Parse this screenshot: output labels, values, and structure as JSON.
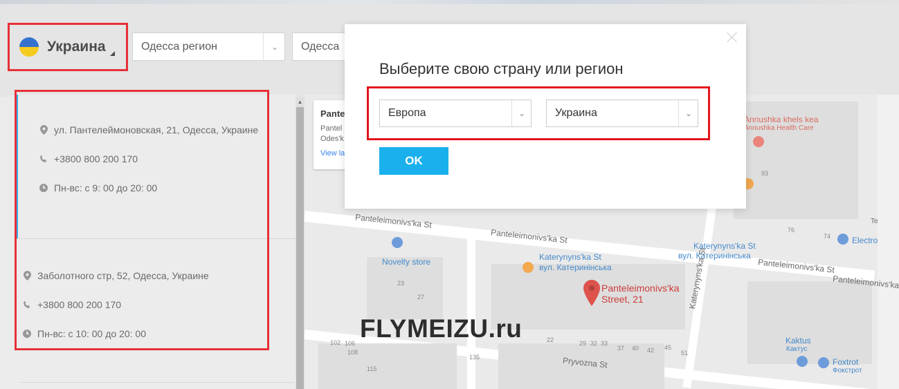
{
  "header": {
    "country_selector": {
      "name": "Украина",
      "flag_icon": "ukraine-flag-icon"
    },
    "region_select": {
      "value": "Одесса регион"
    },
    "city_select": {
      "value": "Одесса"
    }
  },
  "stores": [
    {
      "address": "ул. Пантелеймоновская, 21, Одесса, Украине",
      "phone": "+3800 800 200 170",
      "hours": "Пн-вс: с 9: 00 до 20: 00"
    },
    {
      "address": "Заболотного стр, 52, Одесса, Украине",
      "phone": "+3800 800 200 170",
      "hours": "Пн-вс: с 10: 00 до 20: 00"
    }
  ],
  "map": {
    "card": {
      "title": "Pante",
      "addr_line1": "Pantel",
      "addr_line2": "Odes'k",
      "link": "View la"
    },
    "labels": {
      "street1": "Panteleimonivs'ka St",
      "street2": "Panteleimonivs'ka St",
      "street3": "Panteleimonivs'ka St",
      "street4": "Panteleimonivs'ka St",
      "pryvozna": "Pryvozna St",
      "kateryn_v": "Katerynyns'ka St",
      "novelty": "Novelty store",
      "kateryn_en": "Katerynyns'ka St",
      "kateryn_ru": "вул. Катеринінська",
      "kateryn_en2": "Katerynyns'ka St",
      "kateryn_ru2": "вул. Катеринінська",
      "annushka": "Annushka khels kea",
      "annushka_sub": "Annushka Health Care",
      "electro": "Electro",
      "kaktus": "Kaktus",
      "kaktus_ru": "Кактус",
      "foxtrot": "Foxtrot",
      "foxtrot_ru": "Фокстрот",
      "pin_line1": "Panteleimonivs'ka",
      "pin_line2": "Street, 21",
      "te": "Te"
    },
    "numbers": [
      "23",
      "27",
      "93",
      "76",
      "74",
      "102",
      "115",
      "135",
      "22",
      "29",
      "32",
      "33",
      "37",
      "40",
      "42",
      "45",
      "51",
      "106",
      "108"
    ]
  },
  "watermark": "FLYMEIZU.ru",
  "modal": {
    "title": "Выберите свою страну или регион",
    "region_select": {
      "value": "Европа"
    },
    "country_select": {
      "value": "Украина"
    },
    "ok_label": "OK"
  },
  "colors": {
    "accent": "#19b0ed",
    "highlight": "#e3141d",
    "active_border": "#1aa6e0"
  }
}
